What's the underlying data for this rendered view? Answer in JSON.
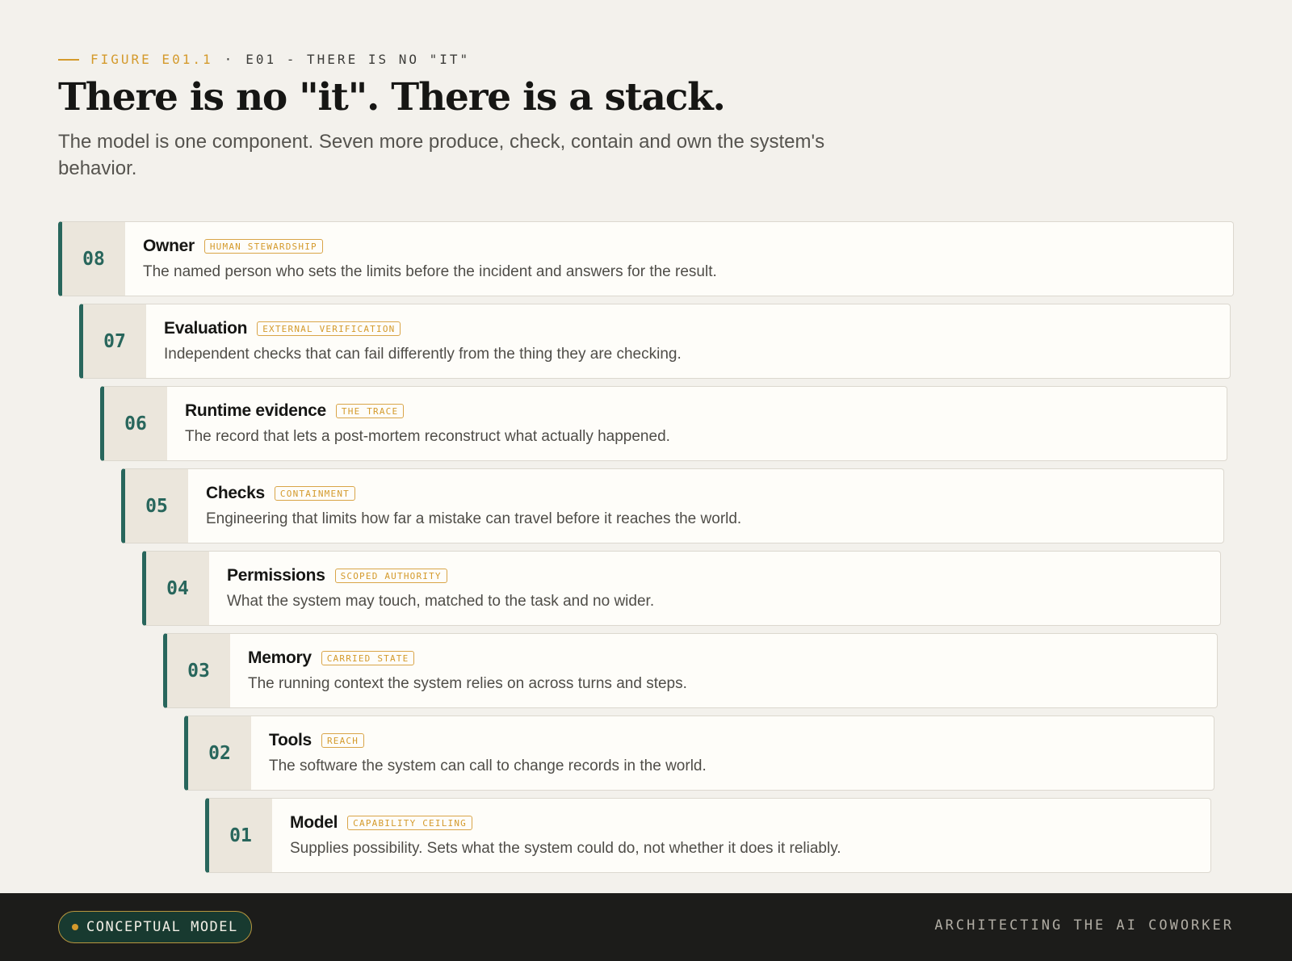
{
  "header": {
    "figure_label": "FIGURE E01.1",
    "separator": "·",
    "section_label": "E01 - THERE IS NO \"IT\"",
    "title": "There is no \"it\". There is a stack.",
    "subtitle": "The model is one component. Seven more produce, check, contain and own the system's behavior."
  },
  "layers": [
    {
      "number": "08",
      "name": "Owner",
      "tag": "HUMAN STEWARDSHIP",
      "description": "The named person who sets the limits before the incident and answers for the result."
    },
    {
      "number": "07",
      "name": "Evaluation",
      "tag": "EXTERNAL VERIFICATION",
      "description": "Independent checks that can fail differently from the thing they are checking."
    },
    {
      "number": "06",
      "name": "Runtime evidence",
      "tag": "THE TRACE",
      "description": "The record that lets a post-mortem reconstruct what actually happened."
    },
    {
      "number": "05",
      "name": "Checks",
      "tag": "CONTAINMENT",
      "description": "Engineering that limits how far a mistake can travel before it reaches the world."
    },
    {
      "number": "04",
      "name": "Permissions",
      "tag": "SCOPED AUTHORITY",
      "description": "What the system may touch, matched to the task and no wider."
    },
    {
      "number": "03",
      "name": "Memory",
      "tag": "CARRIED STATE",
      "description": "The running context the system relies on across turns and steps."
    },
    {
      "number": "02",
      "name": "Tools",
      "tag": "REACH",
      "description": "The software the system can call to change records in the world."
    },
    {
      "number": "01",
      "name": "Model",
      "tag": "CAPABILITY CEILING",
      "description": "Supplies possibility. Sets what the system could do, not whether it does it reliably."
    }
  ],
  "footer": {
    "badge": "CONCEPTUAL MODEL",
    "brand": "ARCHITECTING THE AI COWORKER"
  },
  "colors": {
    "background": "#f3f1ec",
    "accent_teal": "#28665c",
    "accent_amber": "#d49a2c",
    "footer_bg": "#1c1c1a"
  }
}
